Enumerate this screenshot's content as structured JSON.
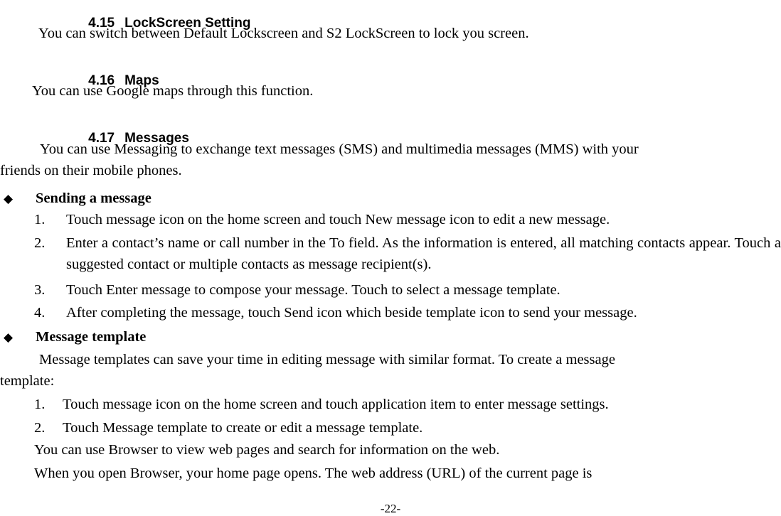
{
  "document": {
    "page_number": "-22-",
    "bullet_glyph": "◆"
  },
  "sections": [
    {
      "number": "4.15",
      "title": "LockScreen Setting",
      "body": "You can switch between Default Lockscreen and S2 LockScreen to lock you screen."
    },
    {
      "number": "4.16",
      "title": "Maps",
      "body": "You can use Google maps through this function."
    },
    {
      "number": "4.17",
      "title": "Messages",
      "body": "You can use Messaging to exchange text messages (SMS) and multimedia messages (MMS) with your friends on their mobile phones."
    }
  ],
  "messages": {
    "intro_line1": "You can use Messaging to exchange text messages (SMS) and multimedia messages (MMS) with your",
    "intro_line2": "friends on their mobile phones.",
    "sending": {
      "label": "Sending a message",
      "steps": [
        "Touch message icon on the home screen and touch New message icon to edit a new message.",
        "Enter a contact’s name or call number in the To field. As the information is entered, all matching contacts appear. Touch a suggested contact or multiple contacts as message recipient(s).",
        "Touch Enter message to compose your message. Touch to select a message template.",
        "After completing the message, touch Send icon which beside template icon to send your message."
      ],
      "markers": [
        "1.",
        "2.",
        "3.",
        "4."
      ]
    },
    "template": {
      "label": "Message template",
      "intro_line1": "Message templates can save your time in editing message with similar format. To create a message",
      "intro_line2": "template:",
      "steps": [
        "Touch message icon on the home screen and touch application item to enter message settings.",
        "Touch Message template to create or edit a message template."
      ],
      "markers": [
        "1.",
        "2."
      ]
    }
  },
  "browser": {
    "line1": "You can use Browser to view web pages and search for information on the web.",
    "line2": "When you open Browser, your home page opens. The web address (URL) of the current page is"
  }
}
